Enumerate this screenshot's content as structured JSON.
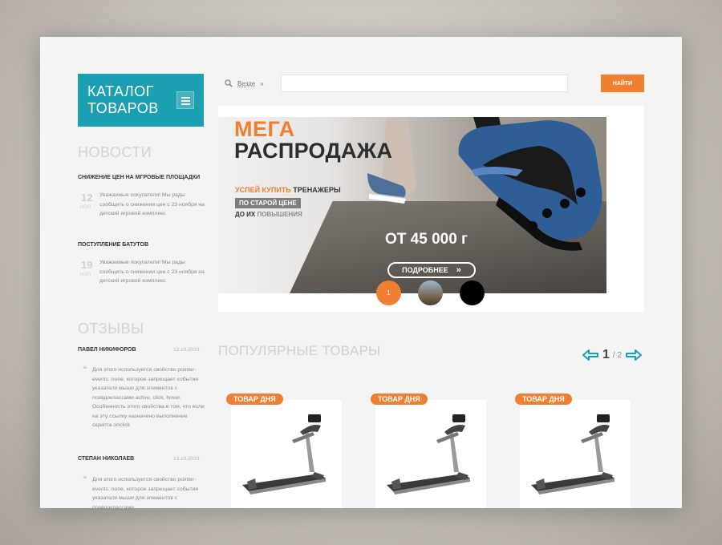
{
  "sidebar": {
    "catalog_title_line1": "КАТАЛОГ",
    "catalog_title_line2": "ТОВАРОВ",
    "news_title": "НОВОСТИ",
    "news": [
      {
        "title": "СНИЖЕНИЕ ЦЕН НА МГРОВЫЕ ПЛОЩАДКИ",
        "day": "12",
        "month": "НОЯ",
        "text": "Уважаемые покупатели! Мы рады сообщить о снижении цен с 23 ноября на детский игровой комплекс"
      },
      {
        "title": "ПОСТУПЛЕНИЕ БАТУТОВ",
        "day": "19",
        "month": "НОЯ",
        "text": "Уважаемые покупатели! Мы рады сообщить о снижении цен с 23 ноября на детский игровой комплекс"
      }
    ],
    "reviews_title": "ОТЗЫВЫ",
    "reviews": [
      {
        "name": "ПАВЕЛ НИКИФОРОВ",
        "date": "12.10.2023",
        "text": "Для этого используется свойство pointer-events: none, которое запрещает события указателя мыши для элементов с псевдоклассами active, click, hover. Особенность этого свойства в том, что если на эту ссылку назначено выполнение скрипта onclick"
      },
      {
        "name": "СТЕПАН НИКОЛАЕВ",
        "date": "13.10.2023",
        "text": "Для этого используется свойство pointer-events: none, которое запрещает события указателя мыши для элементов с псевдоклассами"
      }
    ]
  },
  "search": {
    "scope": "Везде",
    "placeholder": "",
    "button": "НАЙТИ"
  },
  "banner": {
    "title1": "МЕГА",
    "title2": "РАСПРОДАЖА",
    "line1_accent": "УСПЕЙ КУПИТЬ",
    "line1_rest": " ТРЕНАЖЕРЫ",
    "line2": "ПО СТАРОЙ ЦЕНЕ",
    "line3_a": "ДО ИХ ",
    "line3_b": "ПОВЫШЕНИЯ",
    "price": "ОТ 45 000 г",
    "more_button": "ПОДРОБНЕЕ",
    "slide_active": "1"
  },
  "popular": {
    "title": "ПОПУЛЯРНЫЕ ТОВАРЫ",
    "page_current": "1",
    "page_total": "/ 2",
    "products": [
      {
        "badge": "ТОВАР ДНЯ"
      },
      {
        "badge": "ТОВАР ДНЯ"
      },
      {
        "badge": "ТОВАР ДНЯ"
      }
    ]
  },
  "colors": {
    "accent": "#f07f32",
    "teal": "#1b9fb3"
  }
}
